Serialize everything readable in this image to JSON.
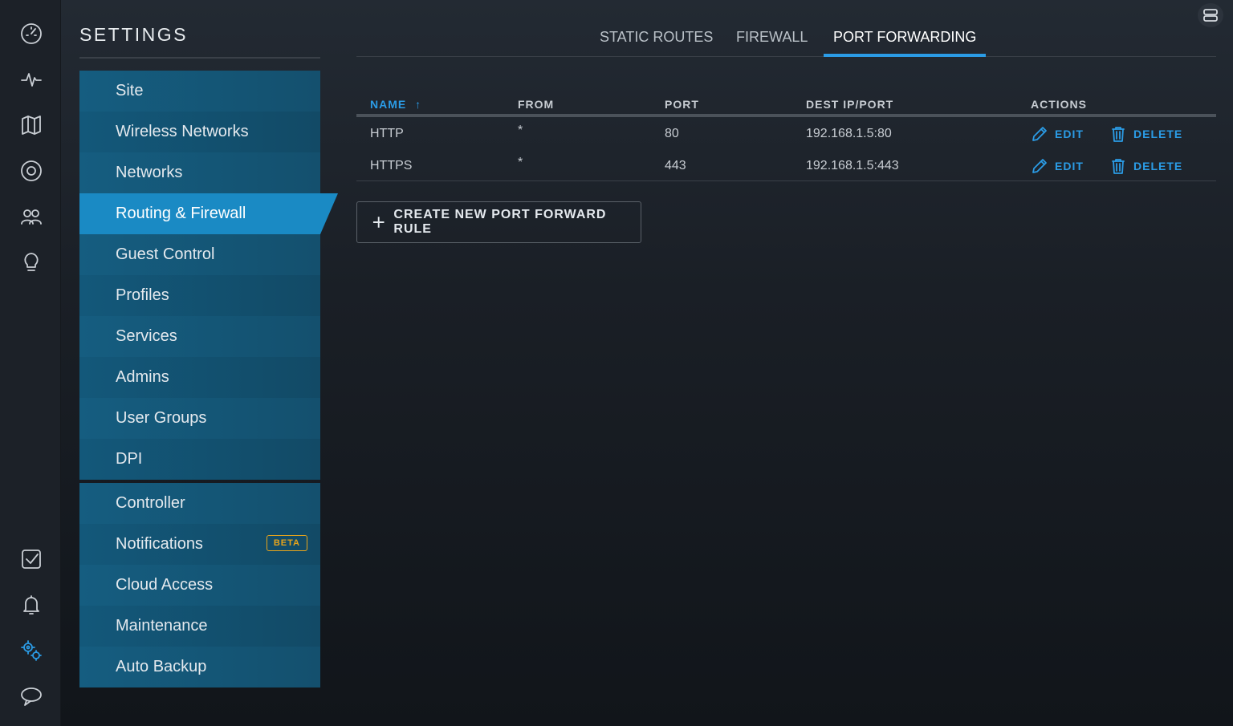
{
  "rail": {
    "top": [
      "dashboard-icon",
      "statistics-icon",
      "map-icon",
      "devices-icon",
      "clients-icon",
      "insights-icon"
    ],
    "bottom": [
      "events-icon",
      "alerts-icon",
      "settings-icon",
      "chat-icon"
    ]
  },
  "settings": {
    "title": "SETTINGS"
  },
  "menu": {
    "group1": [
      "Site",
      "Wireless Networks",
      "Networks",
      "Routing & Firewall",
      "Guest Control",
      "Profiles",
      "Services",
      "Admins",
      "User Groups",
      "DPI"
    ],
    "group2": [
      "Controller",
      "Notifications",
      "Cloud Access",
      "Maintenance",
      "Auto Backup"
    ],
    "active": "Routing & Firewall",
    "badge": "BETA"
  },
  "tabs": [
    "STATIC ROUTES",
    "FIREWALL",
    "PORT FORWARDING"
  ],
  "active_tab": "PORT FORWARDING",
  "table": {
    "headers": {
      "name": "NAME",
      "from": "FROM",
      "port": "PORT",
      "dest": "DEST IP/PORT",
      "actions": "ACTIONS"
    },
    "sort_indicator": "↑",
    "rows": [
      {
        "name": "HTTP",
        "from": "*",
        "port": "80",
        "dest": "192.168.1.5:80"
      },
      {
        "name": "HTTPS",
        "from": "*",
        "port": "443",
        "dest": "192.168.1.5:443"
      }
    ],
    "edit_label": "EDIT",
    "delete_label": "DELETE"
  },
  "create_button": {
    "label": "CREATE NEW PORT FORWARD RULE"
  },
  "colors": {
    "accent": "#2b9ce6",
    "menu_bg": "#14506e",
    "menu_active": "#1a8ac4",
    "beta": "#e8a51b"
  }
}
